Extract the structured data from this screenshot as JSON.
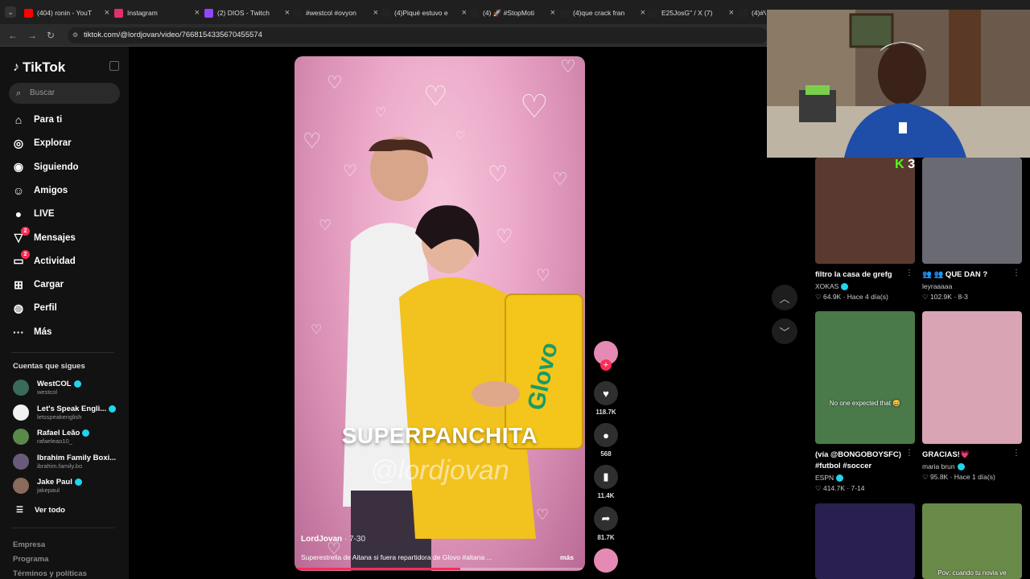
{
  "browser": {
    "tabs": [
      {
        "title": "(404) ronin - YouT",
        "color": "#ff0000"
      },
      {
        "title": "Instagram",
        "color": "#e1306c"
      },
      {
        "title": "(2) DIOS - Twitch",
        "color": "#9146ff"
      },
      {
        "title": "#westcol #ovyon",
        "color": "#222222"
      },
      {
        "title": "(4)Piqué estuvo e",
        "color": "#222222"
      },
      {
        "title": "(4) 🚀 #StopMoti",
        "color": "#222222"
      },
      {
        "title": "(4)que crack fran",
        "color": "#222222"
      },
      {
        "title": "E25JosG\" / X (7)",
        "color": "#222222"
      },
      {
        "title": "(4)#V",
        "color": "#222222"
      }
    ],
    "url": "tiktok.com/@lordjovan/video/7668154335670455574"
  },
  "sidebar": {
    "logo": "TikTok",
    "search_placeholder": "Buscar",
    "nav": [
      {
        "label": "Para ti",
        "icon": "home-icon"
      },
      {
        "label": "Explorar",
        "icon": "compass-icon"
      },
      {
        "label": "Siguiendo",
        "icon": "following-icon"
      },
      {
        "label": "Amigos",
        "icon": "friends-icon"
      },
      {
        "label": "LIVE",
        "icon": "live-icon"
      },
      {
        "label": "Mensajes",
        "icon": "messages-icon",
        "badge": "2"
      },
      {
        "label": "Actividad",
        "icon": "activity-icon",
        "badge": "2"
      },
      {
        "label": "Cargar",
        "icon": "upload-icon"
      },
      {
        "label": "Perfil",
        "icon": "profile-icon"
      },
      {
        "label": "Más",
        "icon": "more-icon"
      }
    ],
    "following_title": "Cuentas que sigues",
    "following": [
      {
        "name": "WestCOL",
        "handle": "westcol",
        "verified": true,
        "color": "#3a6a5a"
      },
      {
        "name": "Let's Speak Engli...",
        "handle": "letsspeakenglish",
        "verified": true,
        "color": "#f2f2f2"
      },
      {
        "name": "Rafael Leão",
        "handle": "rafaeleao10_",
        "verified": true,
        "color": "#5a8a4a"
      },
      {
        "name": "Ibrahim Family Boxi...",
        "handle": "ibrahim.family.bo",
        "verified": false,
        "color": "#6a5a7a"
      },
      {
        "name": "Jake Paul",
        "handle": "jakepaul",
        "verified": true,
        "color": "#8a6a5a"
      }
    ],
    "see_all": "Ver todo",
    "footer": [
      "Empresa",
      "Programa",
      "Términos y políticas"
    ]
  },
  "video": {
    "overlay_title": "SUPERPANCHITA",
    "overlay_handle": "@lordjovan",
    "author": "LordJovan",
    "date": " · 7-30",
    "description": "Superestrella de Aitana si fuera repartidora de Glovo #aitana ...",
    "more": "más",
    "progress": 0.57,
    "bag_text": "Glovo"
  },
  "actions": {
    "likes": "118.7K",
    "comments": "568",
    "saves": "11.4K",
    "shares": "81.7K"
  },
  "recommended": [
    {
      "title": "filtro la casa de grefg",
      "author": "XOKAS",
      "verified": true,
      "likes": "64.9K",
      "time": "Hace 4 día(s)",
      "bg": "#5a3a30",
      "overlay_badge": "3"
    },
    {
      "title": "👥 👥 QUE DAN ?",
      "author": "leyraaaaa",
      "verified": false,
      "likes": "102.9K",
      "time": "8-3",
      "bg": "#6a6a72"
    },
    {
      "title": "(vía @BONGOBOYSFC) #futbol #soccer",
      "author": "ESPN",
      "verified": true,
      "likes": "414.7K",
      "time": "7-14",
      "bg": "#4a7a4a",
      "caption": "No one expected that 😅"
    },
    {
      "title": "GRACIAS!💗",
      "author": "maria brun",
      "verified": true,
      "likes": "95.8K",
      "time": "Hace 1 día(s)",
      "bg": "#d9a4b4"
    },
    {
      "title": "",
      "author": "",
      "likes": "",
      "time": "",
      "bg": "#2a2050"
    },
    {
      "title": "",
      "author": "",
      "likes": "",
      "time": "",
      "bg": "#6a8a4a",
      "caption": "Pov: cuando tu novia ve"
    }
  ]
}
